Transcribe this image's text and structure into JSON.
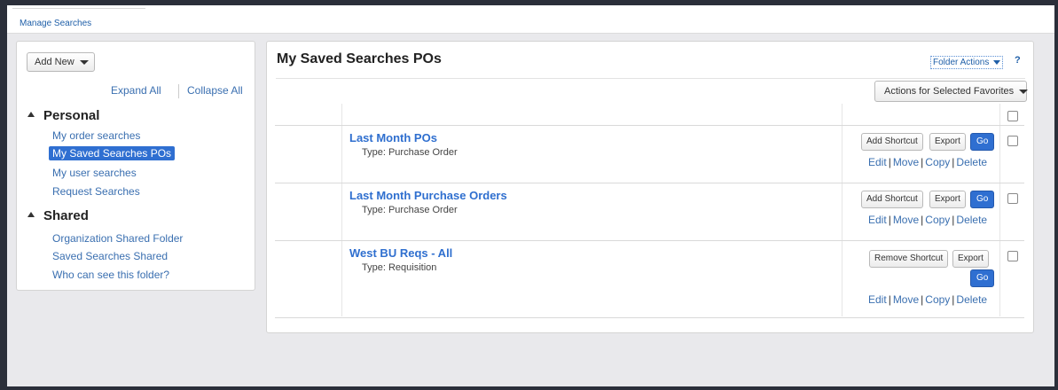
{
  "breadcrumb": {
    "label": "Manage Searches"
  },
  "sidebar": {
    "add_new_label": "Add New",
    "expand_all": "Expand All",
    "collapse_all": "Collapse All",
    "folders": [
      {
        "name": "Personal",
        "items": [
          {
            "label": "My order searches",
            "selected": false
          },
          {
            "label": "My Saved Searches POs",
            "selected": true
          },
          {
            "label": "My user searches",
            "selected": false
          },
          {
            "label": "Request Searches",
            "selected": false
          }
        ]
      },
      {
        "name": "Shared",
        "items": [
          {
            "label": "Organization Shared Folder",
            "selected": false
          },
          {
            "label": "Saved Searches Shared",
            "selected": false
          },
          {
            "label": "Who can see this folder?",
            "selected": false
          }
        ]
      }
    ]
  },
  "main": {
    "title": "My Saved Searches POs",
    "folder_actions_label": "Folder Actions",
    "help_label": "?",
    "actions_selected_label": "Actions for Selected Favorites",
    "rows": [
      {
        "title": "Last Month POs",
        "type": "Type: Purchase Order",
        "shortcut_label": "Add Shortcut",
        "export_label": "Export",
        "go_label": "Go",
        "edit": "Edit",
        "move": "Move",
        "copy": "Copy",
        "delete": "Delete"
      },
      {
        "title": "Last Month Purchase Orders",
        "type": "Type: Purchase Order",
        "shortcut_label": "Add Shortcut",
        "export_label": "Export",
        "go_label": "Go",
        "edit": "Edit",
        "move": "Move",
        "copy": "Copy",
        "delete": "Delete"
      },
      {
        "title": "West BU Reqs - All",
        "type": "Type: Requisition",
        "shortcut_label": "Remove Shortcut",
        "export_label": "Export",
        "go_label": "Go",
        "edit": "Edit",
        "move": "Move",
        "copy": "Copy",
        "delete": "Delete"
      }
    ]
  },
  "colors": {
    "accent": "#2f6fd1",
    "link": "#3a6fb0",
    "frame": "#2b2f3a"
  }
}
